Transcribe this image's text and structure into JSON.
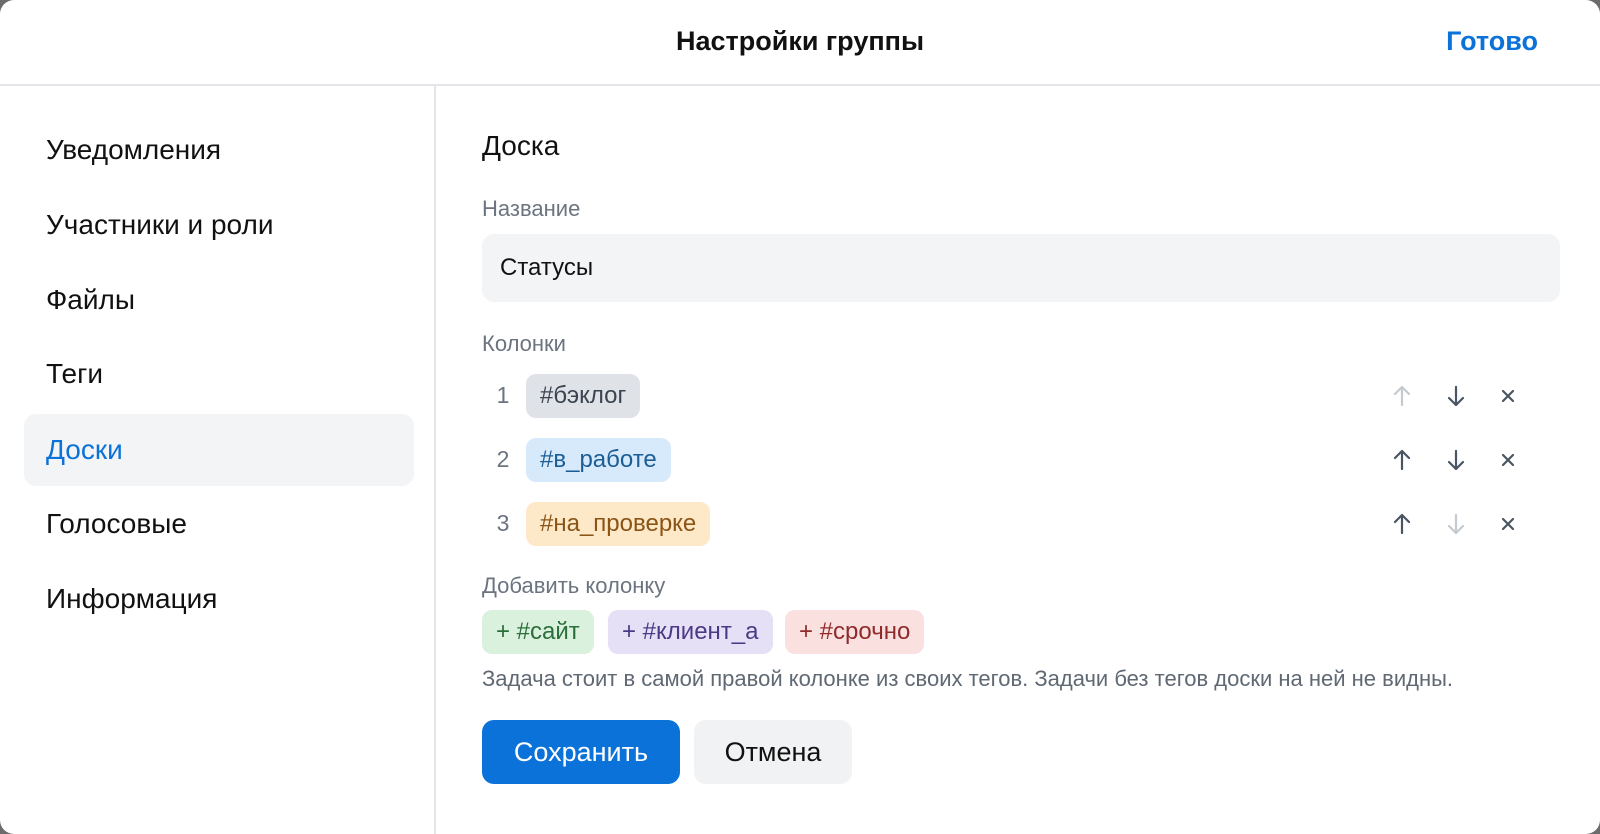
{
  "header": {
    "title": "Настройки группы",
    "done_label": "Готово"
  },
  "sidebar": {
    "items": [
      {
        "label": "Уведомления",
        "active": false
      },
      {
        "label": "Участники и роли",
        "active": false
      },
      {
        "label": "Файлы",
        "active": false
      },
      {
        "label": "Теги",
        "active": false
      },
      {
        "label": "Доски",
        "active": true
      },
      {
        "label": "Голосовые",
        "active": false
      },
      {
        "label": "Информация",
        "active": false
      }
    ]
  },
  "main": {
    "section_title": "Доска",
    "name_label": "Название",
    "name_value": "Статусы",
    "columns_label": "Колонки",
    "columns": [
      {
        "index": "1",
        "tag": "#бэклог",
        "bg": "#dfe3e8",
        "fg": "#3b4450",
        "up_enabled": false,
        "down_enabled": true
      },
      {
        "index": "2",
        "tag": "#в_работе",
        "bg": "#d7eafb",
        "fg": "#1d5d95",
        "up_enabled": true,
        "down_enabled": true
      },
      {
        "index": "3",
        "tag": "#на_проверке",
        "bg": "#fde8c8",
        "fg": "#8a5416",
        "up_enabled": true,
        "down_enabled": false
      }
    ],
    "add_label": "Добавить колонку",
    "add_chips": [
      {
        "label": "+ #сайт",
        "bg": "#d9f1dd",
        "fg": "#2b6e3a"
      },
      {
        "label": "+ #клиент_а",
        "bg": "#e6e0f7",
        "fg": "#4a3a86"
      },
      {
        "label": "+ #срочно",
        "bg": "#fbe0e0",
        "fg": "#8e2c2c"
      }
    ],
    "hint": "Задача стоит в самой правой колонке из своих тегов. Задачи без тегов доски на ней не видны.",
    "save_label": "Сохранить",
    "cancel_label": "Отмена"
  },
  "colors": {
    "accent": "#0a72d8",
    "control_active": "#4a5563",
    "control_disabled": "#c5cad0"
  }
}
